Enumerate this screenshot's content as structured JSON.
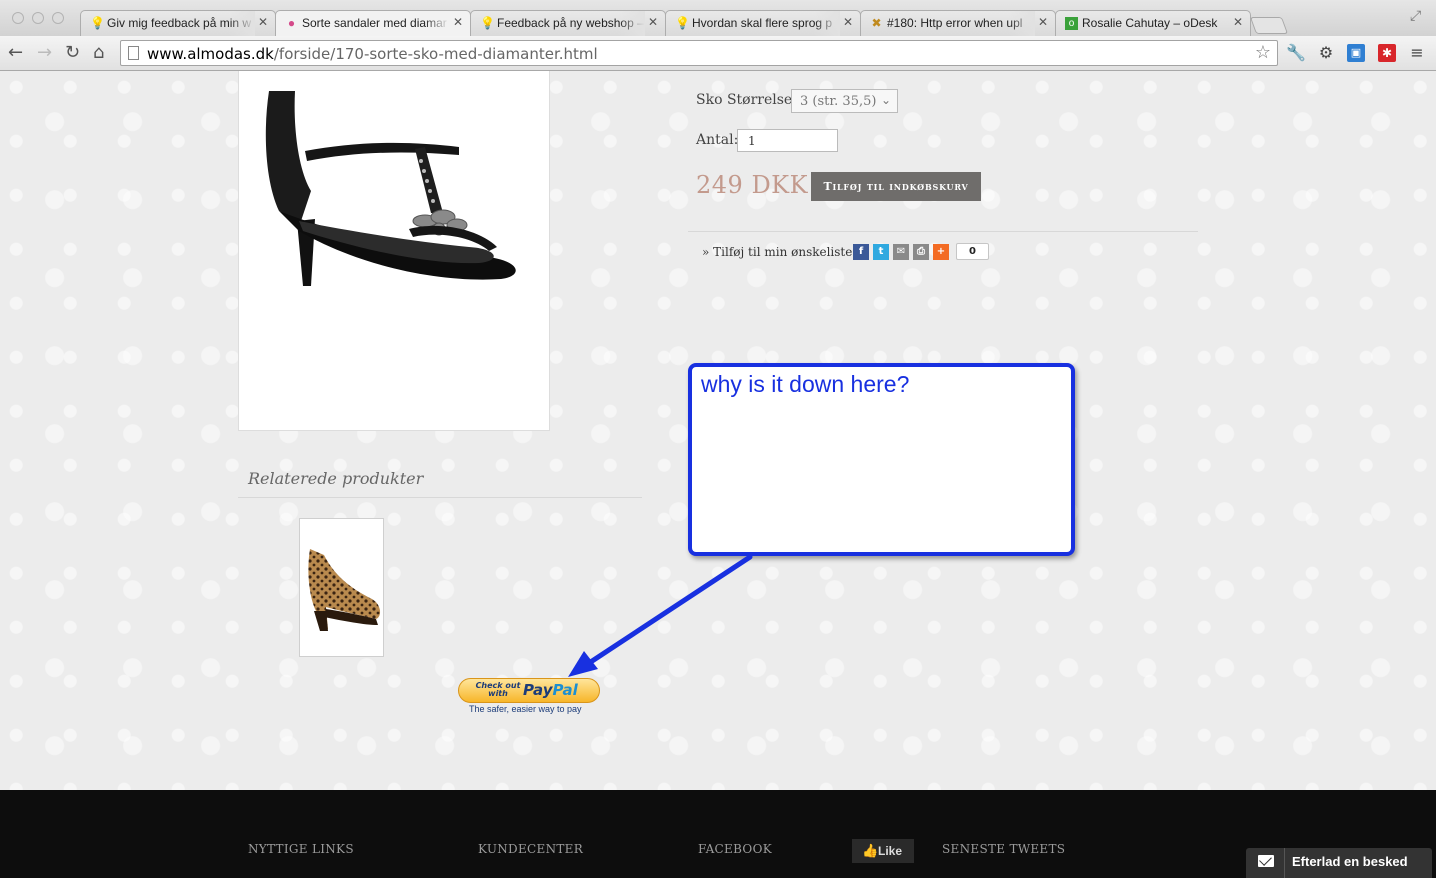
{
  "browser": {
    "tabs": [
      {
        "title": "Giv mig feedback på min w",
        "icon": "lightbulb-icon"
      },
      {
        "title": "Sorte sandaler med diamar",
        "icon": "almodas-favicon"
      },
      {
        "title": "Feedback på ny webshop –",
        "icon": "lightbulb-icon"
      },
      {
        "title": "Hvordan skal flere sprog p",
        "icon": "lightbulb-icon"
      },
      {
        "title": "#180: Http error when upl",
        "icon": "tools-icon"
      },
      {
        "title": "Rosalie Cahutay – oDesk",
        "icon": "odesk-icon"
      }
    ],
    "active_tab": 1,
    "url_host": "www.almodas.dk",
    "url_path": "/forside/170-sorte-sko-med-diamanter.html"
  },
  "product": {
    "size_label": "Sko Størrelse :",
    "size_value": "3 (str. 35,5)",
    "qty_label": "Antal:",
    "qty_value": "1",
    "price": "249 DKK",
    "add_to_cart": "Tilføj til indkøbskurv",
    "wishlist": "» Tilføj til min ønskeliste",
    "share_count": "0"
  },
  "related": {
    "title": "Relaterede produkter"
  },
  "paypal": {
    "checkout": "Check out with",
    "brand_pay": "Pay",
    "brand_pal": "Pal",
    "tagline": "The safer, easier way to pay"
  },
  "annotation": {
    "text": "why is it down here?"
  },
  "footer": {
    "links": "NYTTIGE LINKS",
    "customer": "KUNDECENTER",
    "facebook": "FACEBOOK",
    "like": "Like",
    "tweets": "SENESTE TWEETS",
    "chat": "Efterlad en besked"
  },
  "colors": {
    "price": "#c39a8d",
    "button": "#6f6d6b",
    "annotation": "#1830e0",
    "footer": "#0d0d0d"
  }
}
